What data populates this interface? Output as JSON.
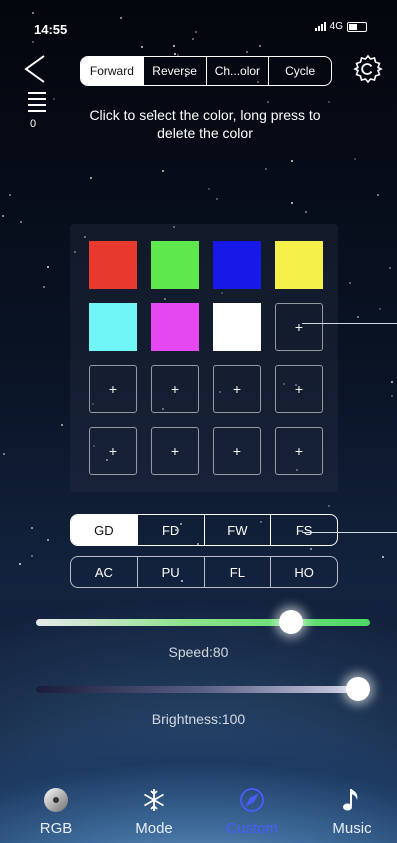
{
  "status_bar": {
    "time": "14:55",
    "network": "4G"
  },
  "header": {
    "direction_tabs": [
      {
        "label": "Forward",
        "active": true
      },
      {
        "label": "Reverse",
        "active": false
      },
      {
        "label": "Ch...olor",
        "active": false
      },
      {
        "label": "Cycle",
        "active": false
      }
    ],
    "menu_count": "0"
  },
  "instructions": "Click to select the color, long press to delete the color",
  "color_grid": {
    "colors": [
      "#e8392e",
      "#5fe84d",
      "#1619e8",
      "#f6f04a",
      "#6ff5f6",
      "#e548f0",
      "#ffffff"
    ],
    "add_label": "+"
  },
  "modes": {
    "row1": [
      {
        "label": "GD",
        "active": true
      },
      {
        "label": "FD",
        "active": false
      },
      {
        "label": "FW",
        "active": false
      },
      {
        "label": "FS",
        "active": false
      }
    ],
    "row2": [
      {
        "label": "AC",
        "active": false
      },
      {
        "label": "PU",
        "active": false
      },
      {
        "label": "FL",
        "active": false
      },
      {
        "label": "HO",
        "active": false
      }
    ]
  },
  "speed": {
    "label": "Speed:80",
    "value": 80,
    "max": 100
  },
  "brightness": {
    "label": "Brightness:100",
    "value": 100,
    "max": 100
  },
  "tabs": [
    {
      "label": "RGB",
      "icon": "rgb-disc-icon",
      "active": false
    },
    {
      "label": "Mode",
      "icon": "snowflake-icon",
      "active": false
    },
    {
      "label": "Custom",
      "icon": "compass-icon",
      "active": true
    },
    {
      "label": "Music",
      "icon": "music-note-icon",
      "active": false
    }
  ],
  "colors": {
    "accent": "#4a5cff",
    "speed_track": "#4cd964"
  }
}
